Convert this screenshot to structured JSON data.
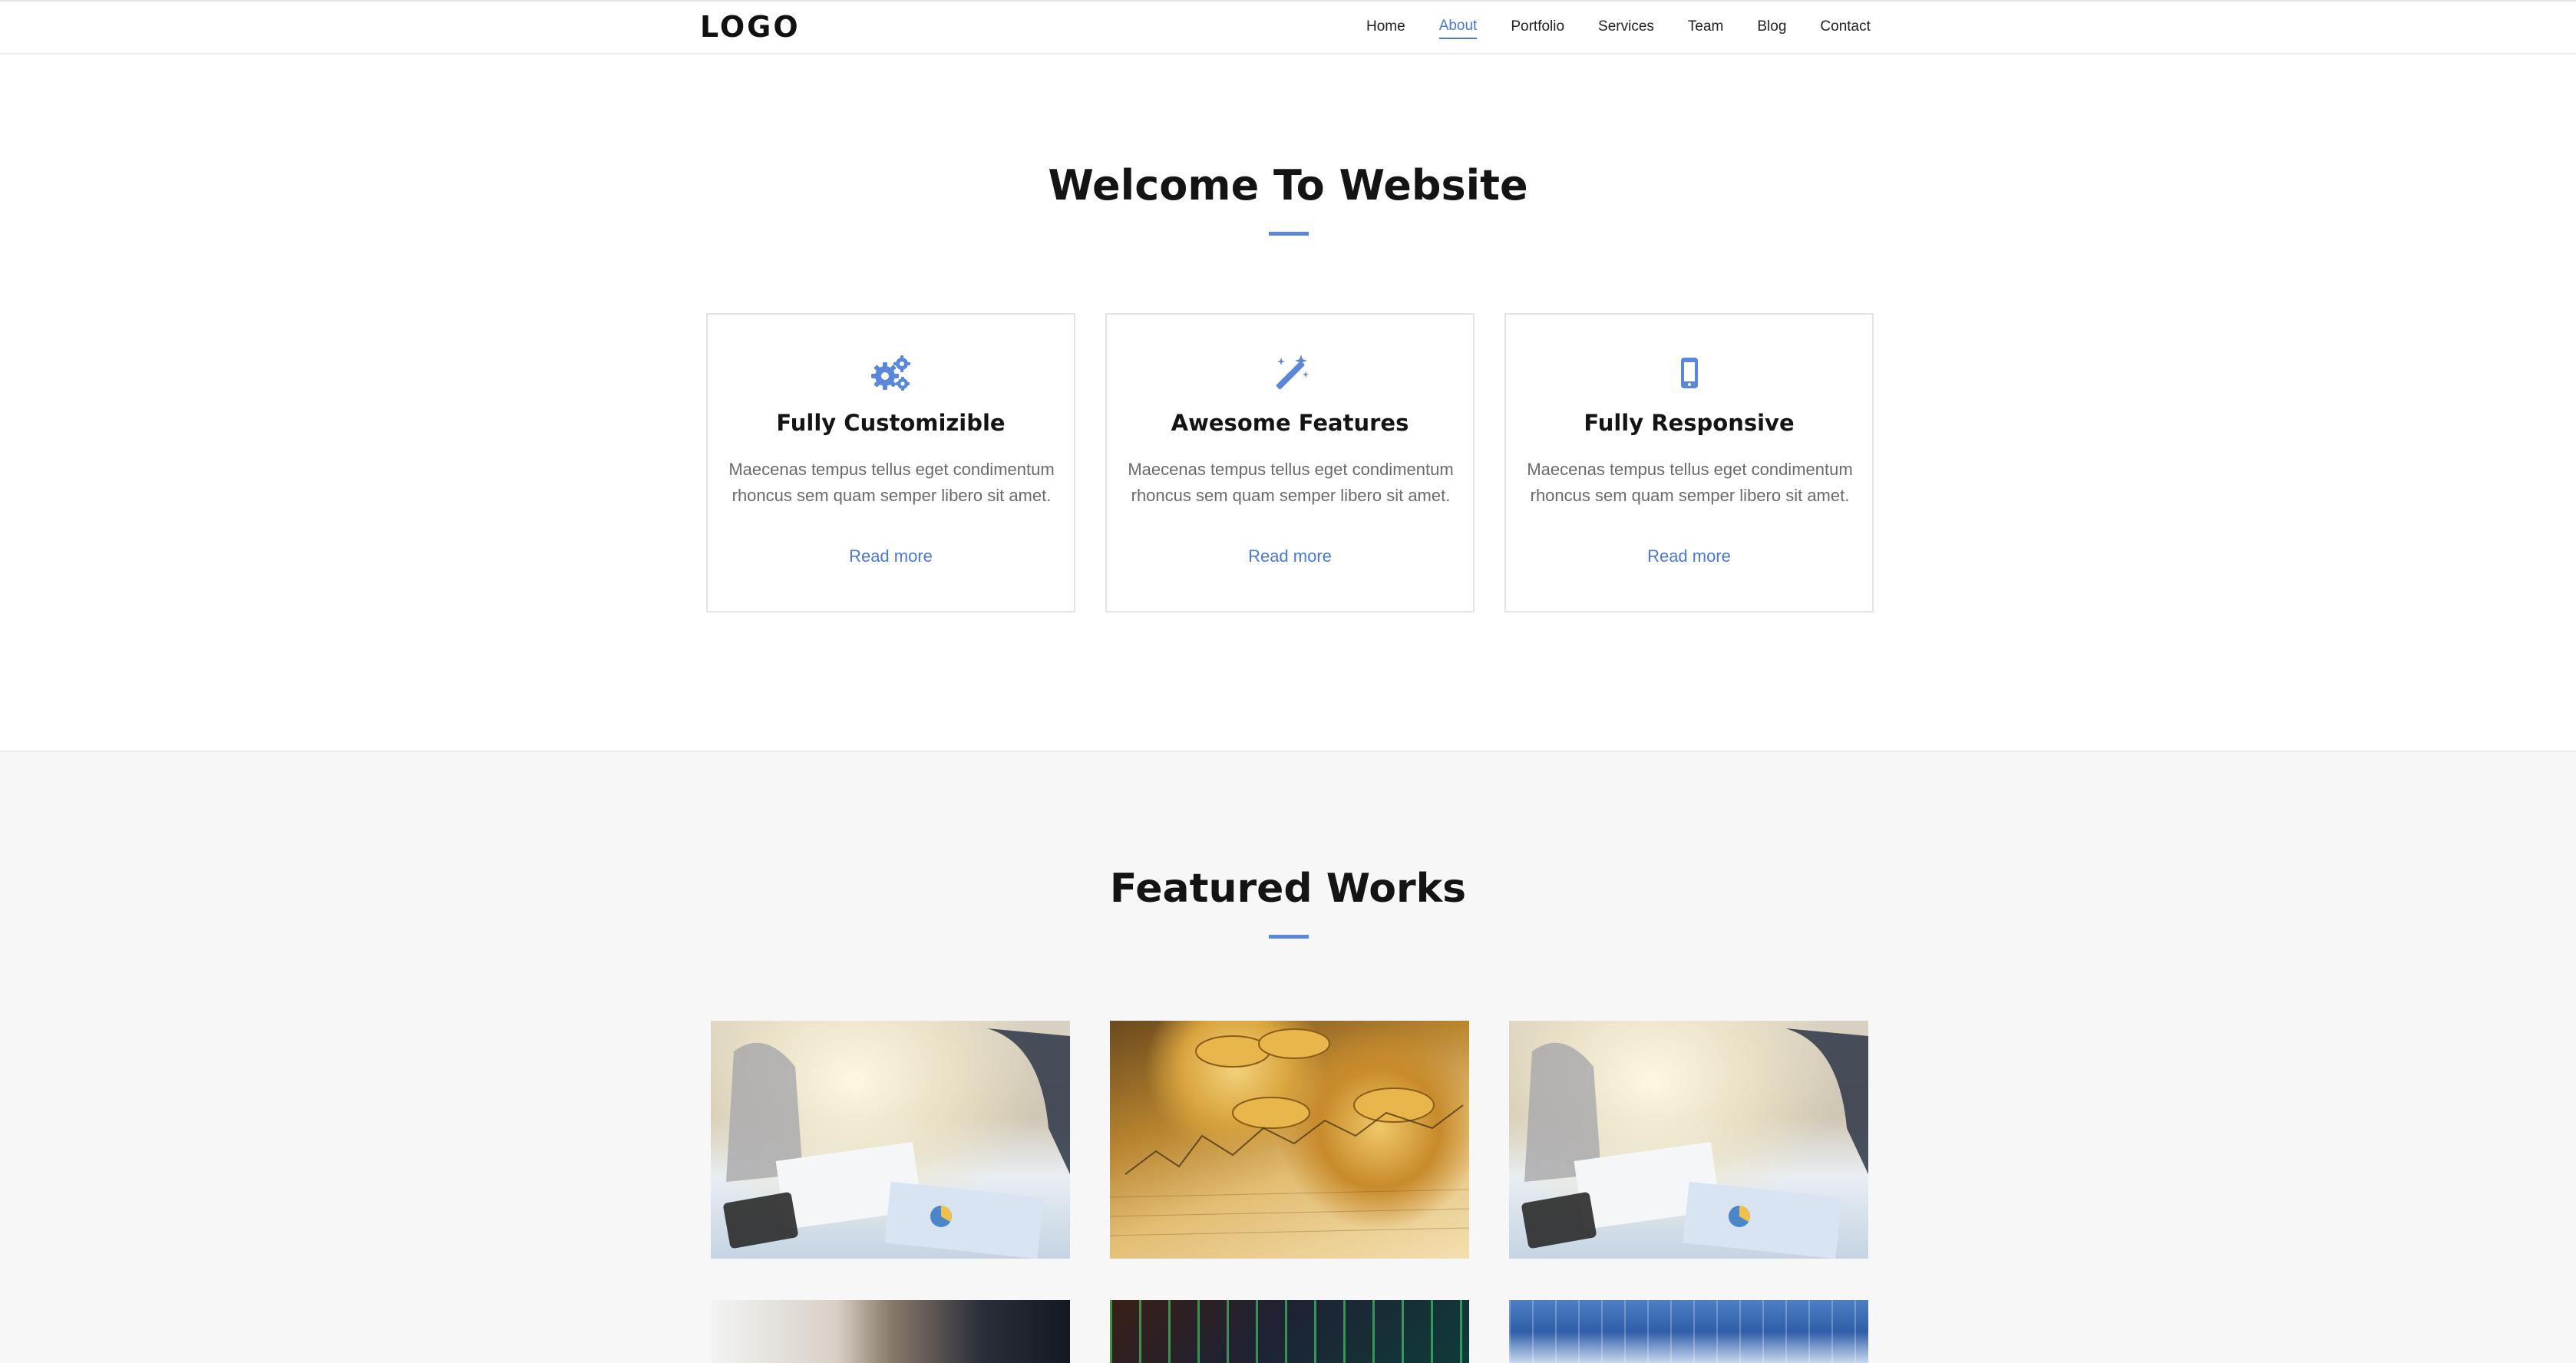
{
  "header": {
    "logo": "LOGO",
    "nav": [
      {
        "label": "Home",
        "active": false
      },
      {
        "label": "About",
        "active": true
      },
      {
        "label": "Portfolio",
        "active": false
      },
      {
        "label": "Services",
        "active": false
      },
      {
        "label": "Team",
        "active": false
      },
      {
        "label": "Blog",
        "active": false
      },
      {
        "label": "Contact",
        "active": false
      }
    ]
  },
  "welcome": {
    "title": "Welcome To Website",
    "cards": [
      {
        "icon": "gears-icon",
        "title": "Fully Customizible",
        "text": "Maecenas tempus tellus eget condimentum rhoncus sem quam semper libero sit amet.",
        "link": "Read more"
      },
      {
        "icon": "magic-wand-icon",
        "title": "Awesome Features",
        "text": "Maecenas tempus tellus eget condimentum rhoncus sem quam semper libero sit amet.",
        "link": "Read more"
      },
      {
        "icon": "mobile-phone-icon",
        "title": "Fully Responsive",
        "text": "Maecenas tempus tellus eget condimentum rhoncus sem quam semper libero sit amet.",
        "link": "Read more"
      }
    ]
  },
  "featured": {
    "title": "Featured Works",
    "works": [
      {
        "image": "office-meeting-photo"
      },
      {
        "image": "gold-coins-chart-photo"
      },
      {
        "image": "office-meeting-photo"
      },
      {
        "image": "handshake-photo"
      },
      {
        "image": "stock-market-screen-photo"
      },
      {
        "image": "city-finance-photo"
      }
    ]
  },
  "colors": {
    "accent": "#4a78d4",
    "underline": "#5b87db",
    "section_bg": "#f7f7f7",
    "text_muted": "#6a6a6a",
    "heading": "#141414"
  }
}
